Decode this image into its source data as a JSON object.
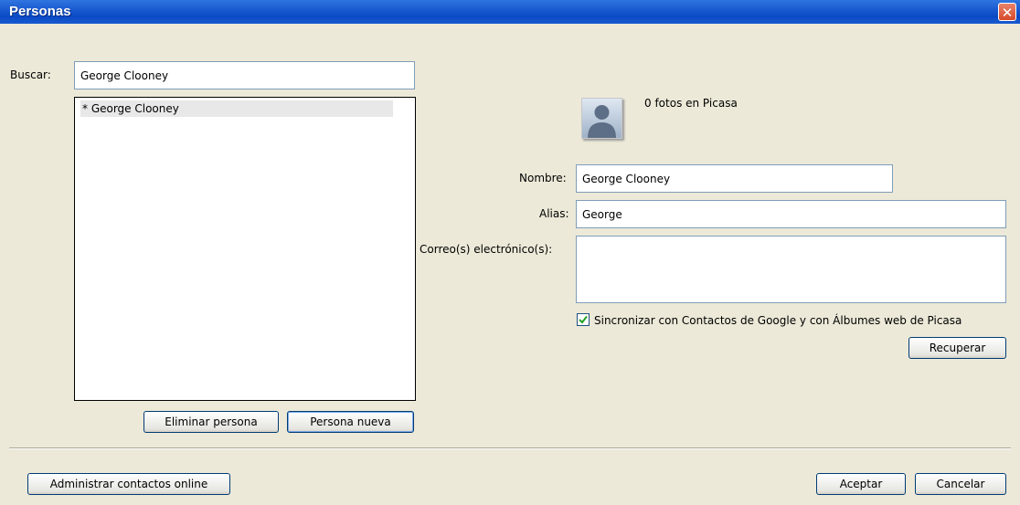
{
  "window": {
    "title": "Personas",
    "close_glyph": "✕"
  },
  "search": {
    "label": "Buscar:",
    "value": "George Clooney"
  },
  "people_list": {
    "items": [
      "* George Clooney"
    ]
  },
  "list_buttons": {
    "delete": "Eliminar persona",
    "new": "Persona nueva"
  },
  "profile": {
    "photo_count": "0 fotos en Picasa",
    "name_label": "Nombre:",
    "name_value": "George Clooney",
    "alias_label": "Alias:",
    "alias_value": "George",
    "email_label": "Correo(s) electrónico(s):",
    "email_value": "",
    "sync_label": "Sincronizar con Contactos de Google y con Álbumes web de Picasa",
    "sync_checked": true,
    "recover_button": "Recuperar"
  },
  "footer": {
    "manage_online": "Administrar contactos online",
    "accept": "Aceptar",
    "cancel": "Cancelar"
  },
  "icons": {
    "avatar": "person-silhouette-icon",
    "close": "close-icon",
    "checkbox": "checkmark-icon"
  },
  "colors": {
    "titlebar": "#0a49c4",
    "dialog_bg": "#ece9d8",
    "close_button": "#d84a2a"
  }
}
